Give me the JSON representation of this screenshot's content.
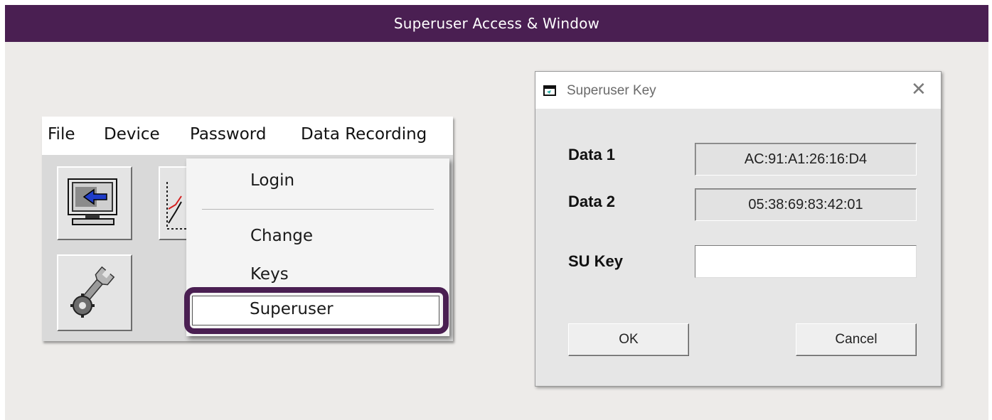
{
  "banner": {
    "title": "Superuser Access & Window"
  },
  "menubar": {
    "items": [
      {
        "label": "File"
      },
      {
        "label": "Device"
      },
      {
        "label": "Password"
      },
      {
        "label": "Data Recording"
      }
    ]
  },
  "password_menu": {
    "items": [
      {
        "label": "Login"
      },
      {
        "label": "Change"
      },
      {
        "label": "Keys"
      },
      {
        "label": "Superuser",
        "highlighted": true
      }
    ]
  },
  "dialog": {
    "title": "Superuser Key",
    "fields": {
      "data1": {
        "label": "Data 1",
        "value": "AC:91:A1:26:16:D4"
      },
      "data2": {
        "label": "Data 2",
        "value": "05:38:69:83:42:01"
      },
      "su_key": {
        "label": "SU Key",
        "value": ""
      }
    },
    "ok_label": "OK",
    "cancel_label": "Cancel"
  },
  "colors": {
    "accent": "#4a1f52",
    "dialog_bg": "#e6e6e6"
  }
}
